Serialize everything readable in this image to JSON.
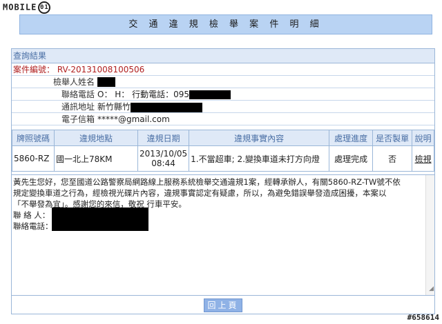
{
  "logo": {
    "text": "MOBILE",
    "mark": "01"
  },
  "page_title": "交 通 違 規 檢 舉 案 件 明 細",
  "result_header": "查詢結果",
  "info": {
    "case_label": "案件編號：",
    "case_value": "RV-20131008100506",
    "reporter_label": "檢舉人姓名",
    "phone_label": "聯絡電話",
    "phone_value": "O：  H：   行動電話：095",
    "address_label": "通訊地址",
    "address_value": "新竹縣竹",
    "email_label": "電子信箱",
    "email_value": "*****@gmail.com"
  },
  "table": {
    "headers": [
      "牌照號碼",
      "違規地點",
      "違規日期",
      "違規事實內容",
      "處理進度",
      "是否製單",
      "說明"
    ],
    "row": {
      "plate": "5860-RZ",
      "location": "國一北上78KM",
      "date": "2013/10/05",
      "time": "08:44",
      "facts": "1.不當超車; 2.變換車道未打方向燈",
      "progress": "處理完成",
      "ticketed": "否",
      "detail": "檢視"
    }
  },
  "message": {
    "lines": [
      "黃先生您好，您至國道公路警察局網路線上服務系統檢舉交通違規1案，經轉承辦人，有關5860-RZ-TW號不依",
      "規定變換車道之行為，經檢視光碟片內容，違規事實認定有疑慮，所以，為避免錯誤舉發造成困擾，本案以",
      "「不舉發為宜」。感謝您的來信，敬祝  行車平安。",
      "聯 絡 人：",
      "聯絡電話："
    ]
  },
  "back_button": "回上頁",
  "watermark": "#658614"
}
